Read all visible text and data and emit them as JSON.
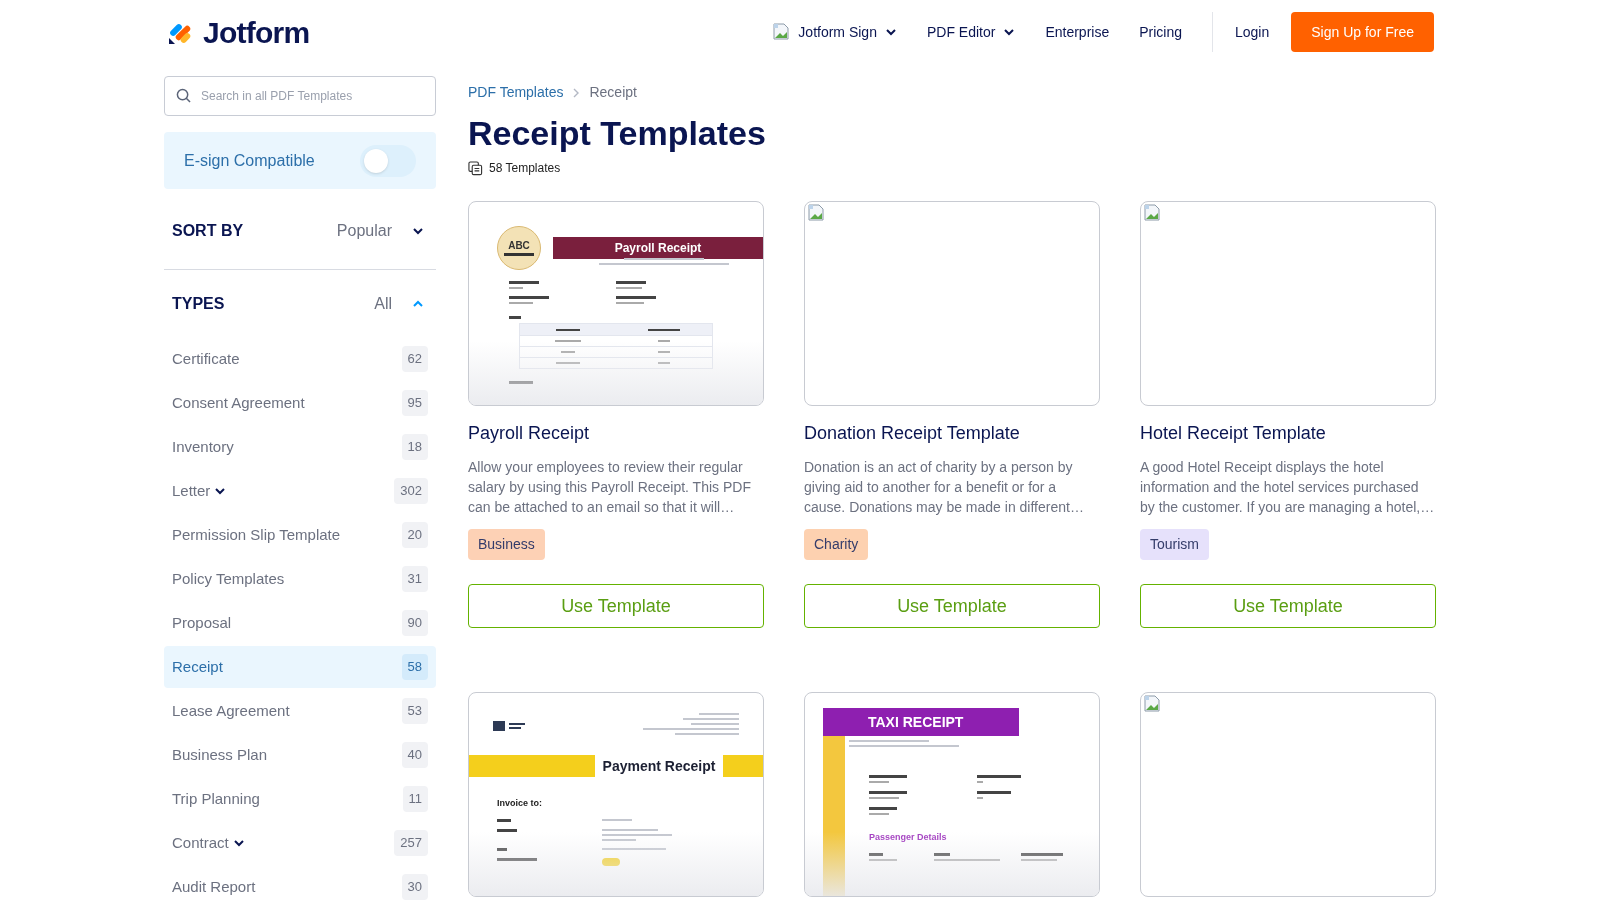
{
  "header": {
    "logo": "Jotform",
    "nav": [
      {
        "label": "Jotform Sign",
        "dropdown": true,
        "broken_image": true
      },
      {
        "label": "PDF Editor",
        "dropdown": true,
        "broken_image": false
      },
      {
        "label": "Enterprise",
        "dropdown": false,
        "broken_image": false
      },
      {
        "label": "Pricing",
        "dropdown": false,
        "broken_image": false
      }
    ],
    "login": "Login",
    "signup": "Sign Up for Free"
  },
  "sidebar": {
    "search": {
      "placeholder": "Search in all PDF Templates"
    },
    "esign": {
      "label": "E-sign Compatible",
      "on": false
    },
    "sort": {
      "label": "SORT BY",
      "value": "Popular"
    },
    "types": {
      "label": "TYPES",
      "value": "All",
      "expanded": true,
      "items": [
        {
          "label": "Certificate",
          "count": "62",
          "selected": false,
          "expandable": false
        },
        {
          "label": "Consent Agreement",
          "count": "95",
          "selected": false,
          "expandable": false
        },
        {
          "label": "Inventory",
          "count": "18",
          "selected": false,
          "expandable": false
        },
        {
          "label": "Letter",
          "count": "302",
          "selected": false,
          "expandable": true
        },
        {
          "label": "Permission Slip Template",
          "count": "20",
          "selected": false,
          "expandable": false
        },
        {
          "label": "Policy Templates",
          "count": "31",
          "selected": false,
          "expandable": false
        },
        {
          "label": "Proposal",
          "count": "90",
          "selected": false,
          "expandable": false
        },
        {
          "label": "Receipt",
          "count": "58",
          "selected": true,
          "expandable": false
        },
        {
          "label": "Lease Agreement",
          "count": "53",
          "selected": false,
          "expandable": false
        },
        {
          "label": "Business Plan",
          "count": "40",
          "selected": false,
          "expandable": false
        },
        {
          "label": "Trip Planning",
          "count": "11",
          "selected": false,
          "expandable": false
        },
        {
          "label": "Contract",
          "count": "257",
          "selected": false,
          "expandable": true
        },
        {
          "label": "Audit Report",
          "count": "30",
          "selected": false,
          "expandable": false
        }
      ]
    }
  },
  "breadcrumb": [
    "PDF Templates",
    "Receipt"
  ],
  "title": "Receipt Templates",
  "count": "58 Templates",
  "templates": [
    {
      "title": "Payroll Receipt",
      "description": "Allow your employees to review their regular salary by using this Payroll Receipt. This PDF can be attached to an email so that it will…",
      "tag": {
        "label": "Business",
        "color": "#fdd1b5"
      },
      "button": "Use Template",
      "preview": {
        "kind": "payroll",
        "logo": "ABC",
        "heading": "Payroll Receipt"
      }
    },
    {
      "title": "Donation Receipt Template",
      "description": "Donation is an act of charity by a person by giving aid to another for a benefit or for a cause. Donations may be made in different…",
      "tag": {
        "label": "Charity",
        "color": "#fdd1b0"
      },
      "button": "Use Template",
      "preview": {
        "kind": "broken"
      }
    },
    {
      "title": "Hotel Receipt Template",
      "description": "A good Hotel Receipt displays the hotel information and the hotel services purchased by the customer. If you are managing a hotel,…",
      "tag": {
        "label": "Tourism",
        "color": "#e6e1fb"
      },
      "button": "Use Template",
      "preview": {
        "kind": "broken"
      }
    },
    {
      "preview": {
        "kind": "payment",
        "heading": "Payment Receipt",
        "subheading": "Invoice to:"
      }
    },
    {
      "preview": {
        "kind": "taxi",
        "heading": "TAXI RECEIPT",
        "section": "Passenger Details"
      }
    },
    {
      "preview": {
        "kind": "broken"
      }
    }
  ]
}
